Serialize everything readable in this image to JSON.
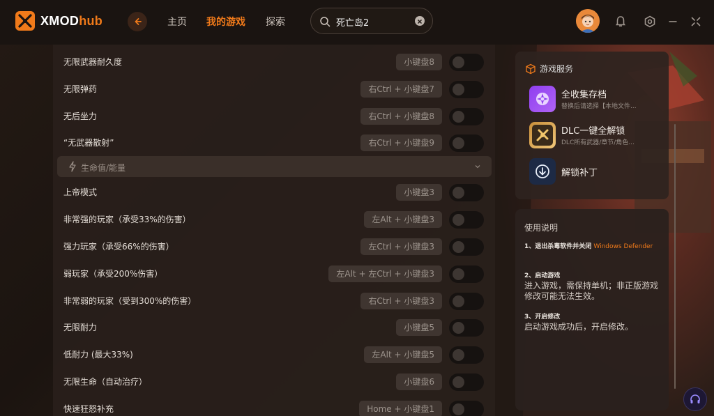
{
  "app": {
    "logo_main": "XMOD",
    "logo_accent": "hub"
  },
  "nav": {
    "home": "主页",
    "my_games": "我的游戏",
    "explore": "探索"
  },
  "search": {
    "value": "死亡岛2"
  },
  "colors": {
    "accent": "#f07a1a",
    "panel": "#281f1b",
    "toggle_off": "#161210"
  },
  "cheats": [
    {
      "name": "无限武器耐久度",
      "key": "小键盘8",
      "enabled": false
    },
    {
      "name": "无限弹药",
      "key": "右Ctrl + 小键盘7",
      "enabled": false
    },
    {
      "name": "无后坐力",
      "key": "右Ctrl + 小键盘8",
      "enabled": false
    },
    {
      "name": "“无武器散射”",
      "key": "右Ctrl + 小键盘9",
      "enabled": false
    }
  ],
  "section": {
    "label": "生命值/能量"
  },
  "cheats2": [
    {
      "name": "上帝模式",
      "key": "小键盘3",
      "enabled": false
    },
    {
      "name": "非常强的玩家（承受33%的伤害）",
      "key": "左Alt + 小键盘3",
      "enabled": false
    },
    {
      "name": "强力玩家（承受66%的伤害）",
      "key": "左Ctrl + 小键盘3",
      "enabled": false
    },
    {
      "name": "弱玩家（承受200%伤害）",
      "key": "左Alt + 左Ctrl + 小键盘3",
      "enabled": false
    },
    {
      "name": "非常弱的玩家（受到300%的伤害）",
      "key": "右Ctrl + 小键盘3",
      "enabled": false
    },
    {
      "name": "无限耐力",
      "key": "小键盘5",
      "enabled": false
    },
    {
      "name": "低耐力 (最大33%)",
      "key": "左Alt + 小键盘5",
      "enabled": false
    },
    {
      "name": "无限生命（自动治疗）",
      "key": "小键盘6",
      "enabled": false
    },
    {
      "name": "快速狂怒补充",
      "key": "Home + 小键盘1",
      "enabled": false
    }
  ],
  "services": {
    "title": "游戏服务",
    "items": [
      {
        "title": "全收集存档",
        "subtitle": "替换后请选择【本地文件..."
      },
      {
        "title": "DLC一键全解锁",
        "subtitle": "DLC所有武器/章节/角色..."
      },
      {
        "title": "解锁补丁",
        "subtitle": ""
      }
    ]
  },
  "instructions": {
    "title": "使用说明",
    "steps": [
      {
        "head": "1、退出杀毒软件并关闭",
        "highlight": "Windows Defender",
        "body": ""
      },
      {
        "head": "2、启动游戏",
        "highlight": "",
        "body": "进入游戏，需保持单机；非正版游戏修改可能无法生效。"
      },
      {
        "head": "3、开启修改",
        "highlight": "",
        "body": "启动游戏成功后，开启修改。"
      }
    ]
  }
}
